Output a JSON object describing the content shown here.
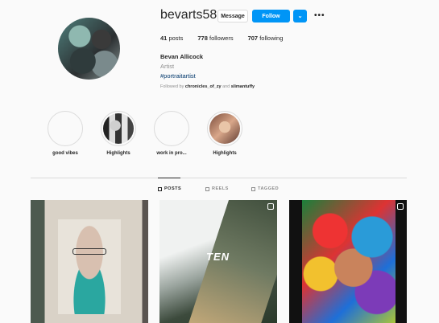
{
  "profile": {
    "username": "bevarts58",
    "full_name": "Bevan Allicock",
    "category": "Artist",
    "hashtag": "#portraitartist",
    "followed_by_prefix": "Followed by",
    "followed_by_user1": "chronicles_of_zy",
    "followed_by_and": "and",
    "followed_by_user2": "slimantuffy"
  },
  "actions": {
    "message_label": "Message",
    "follow_label": "Follow",
    "dropdown_glyph": "⌄",
    "more_glyph": "•••"
  },
  "stats": [
    {
      "value": "41",
      "label": "posts"
    },
    {
      "value": "778",
      "label": "followers"
    },
    {
      "value": "707",
      "label": "following"
    }
  ],
  "highlights": [
    {
      "label": "good vibes"
    },
    {
      "label": "Highlights"
    },
    {
      "label": "work in pro..."
    },
    {
      "label": "Highlights"
    }
  ],
  "tabs": [
    {
      "label": "POSTS",
      "icon": "grid-icon",
      "active": true
    },
    {
      "label": "REELS",
      "icon": "reels-icon",
      "active": false
    },
    {
      "label": "TAGGED",
      "icon": "tagged-icon",
      "active": false
    }
  ],
  "posts": [
    {
      "icon": null
    },
    {
      "text": "TEN",
      "icon": "reel-icon"
    },
    {
      "icon": "reel-icon"
    }
  ],
  "colors": {
    "accent": "#0095f6",
    "text": "#262626",
    "muted": "#8e8e8e",
    "link": "#00376b"
  }
}
